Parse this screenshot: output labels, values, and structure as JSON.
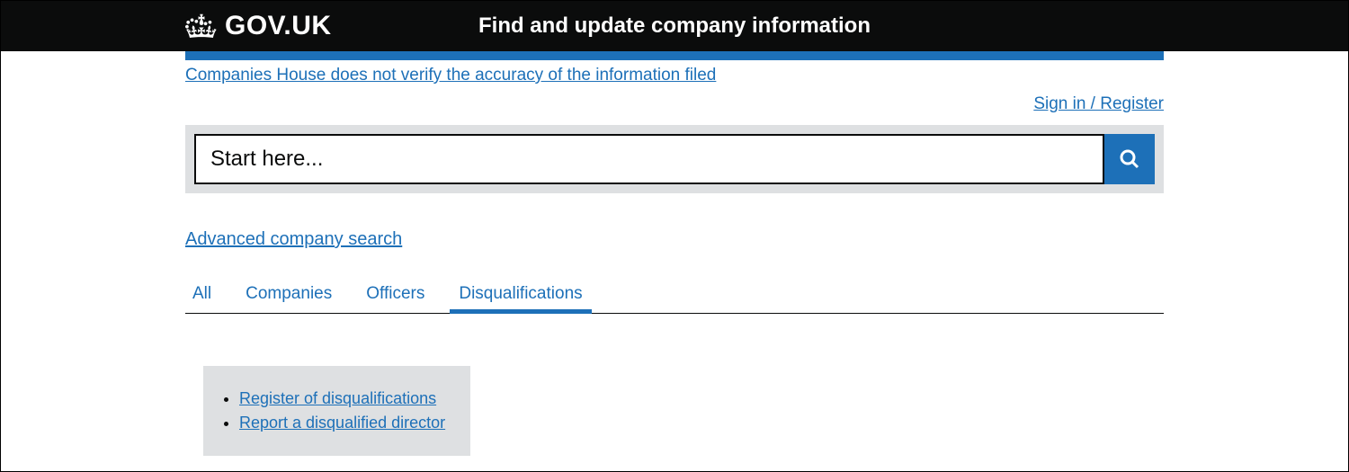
{
  "header": {
    "logo_text": "GOV.UK",
    "title": "Find and update company information"
  },
  "disclaimer": "Companies House does not verify the accuracy of the information filed",
  "sign_in": "Sign in / Register",
  "search": {
    "placeholder": "Start here..."
  },
  "advanced_search": "Advanced company search",
  "tabs": {
    "all": "All",
    "companies": "Companies",
    "officers": "Officers",
    "disqualifications": "Disqualifications"
  },
  "info_links": {
    "register": "Register of disqualifications",
    "report": "Report a disqualified director"
  }
}
